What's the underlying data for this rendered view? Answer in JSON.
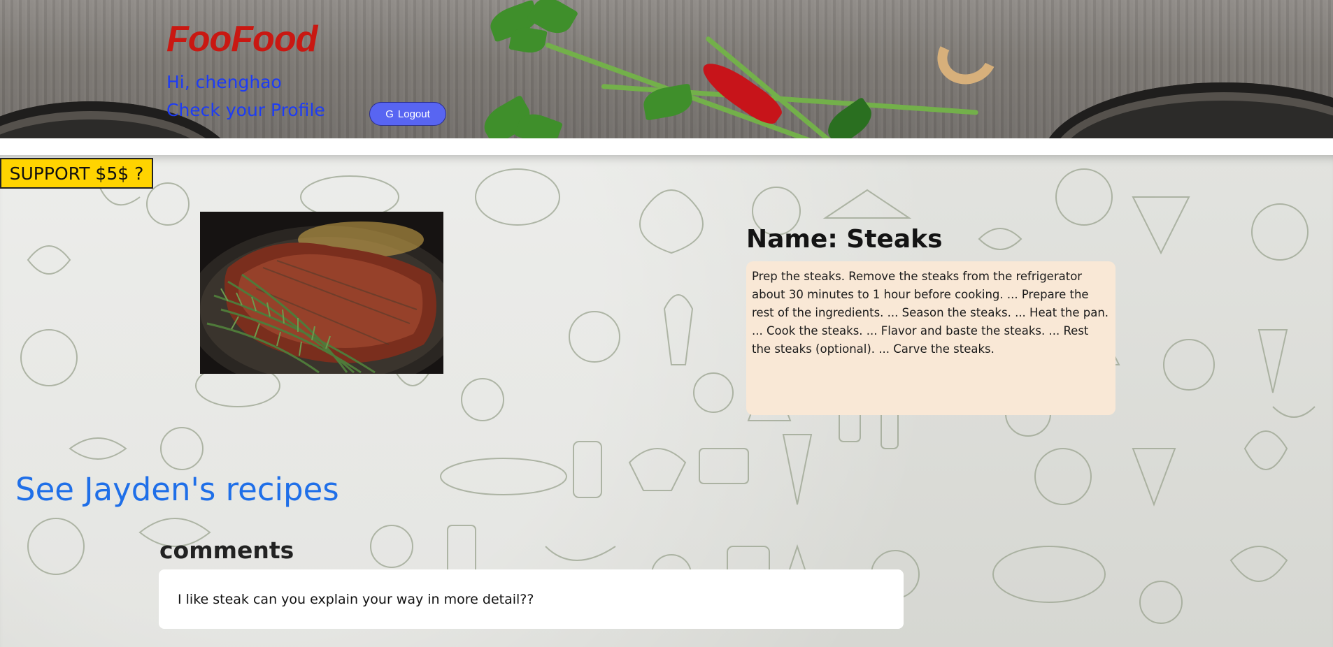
{
  "header": {
    "brand": "FooFood",
    "greeting": "Hi, chenghao",
    "profile_link": "Check your Profile",
    "logout_label": "Logout",
    "logout_icon": "google-g-icon"
  },
  "support_button": "SUPPORT $5$ ?",
  "recipe": {
    "title": "Name: Steaks",
    "description": "Prep the steaks. Remove the steaks from the refrigerator about 30 minutes to 1 hour before cooking. ... Prepare the rest of the ingredients. ... Season the steaks. ... Heat the pan. ... Cook the steaks. ... Flavor and baste the steaks. ... Rest the steaks (optional). ... Carve the steaks."
  },
  "author_link": "See Jayden's recipes",
  "comments": {
    "heading": "comments",
    "items": [
      {
        "text": "I like steak can you explain your way in more detail??"
      }
    ]
  },
  "colors": {
    "brand": "#c91812",
    "link_blue": "#1d3cf5",
    "logout_button": "#5865f2",
    "support_button": "#ffd400",
    "recipe_card": "#f9e8d6",
    "author_link": "#1f6fe8"
  }
}
